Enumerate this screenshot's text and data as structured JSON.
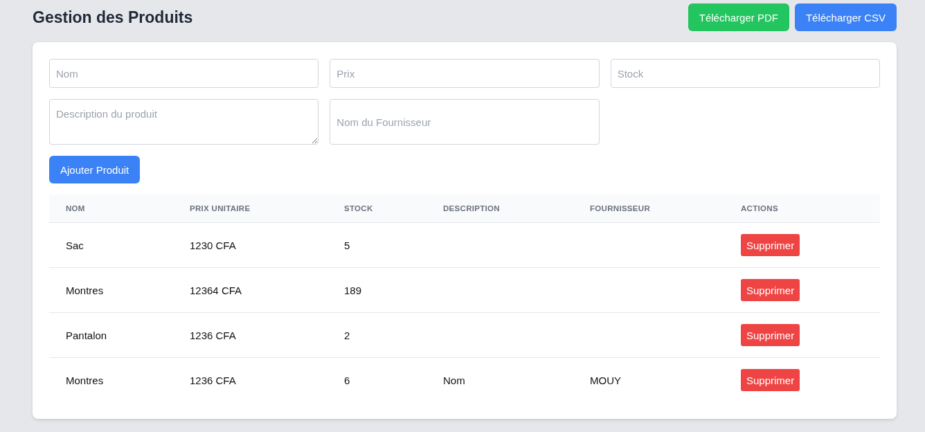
{
  "header": {
    "title": "Gestion des Produits",
    "buttons": [
      {
        "label": "Télécharger PDF",
        "kind": "pdf"
      },
      {
        "label": "Télécharger CSV",
        "kind": "csv"
      }
    ]
  },
  "form": {
    "fields": [
      {
        "kind": "input",
        "placeholder": "Nom"
      },
      {
        "kind": "input",
        "placeholder": "Prix"
      },
      {
        "kind": "input",
        "placeholder": "Stock"
      },
      {
        "kind": "textarea",
        "placeholder": "Description du produit"
      },
      {
        "kind": "input-tall",
        "placeholder": "Nom du Fournisseur"
      }
    ],
    "submit": "Ajouter Produit"
  },
  "table": {
    "columns": [
      "NOM",
      "PRIX UNITAIRE",
      "STOCK",
      "DESCRIPTION",
      "FOURNISSEUR",
      "ACTIONS"
    ],
    "rows": [
      {
        "nom": "Sac",
        "prix": "1230 CFA",
        "stock": "5",
        "action": "Supprimer"
      },
      {
        "nom": "Montres",
        "prix": "12364 CFA",
        "stock": "189",
        "action": "Supprimer"
      },
      {
        "nom": "Pantalon",
        "prix": "1236 CFA",
        "stock": "2",
        "action": "Supprimer"
      },
      {
        "nom": "Montres",
        "prix": "1236 CFA",
        "stock": "6",
        "description": "Nom",
        "fournisseur": "MOUY",
        "action": "Supprimer"
      }
    ]
  }
}
